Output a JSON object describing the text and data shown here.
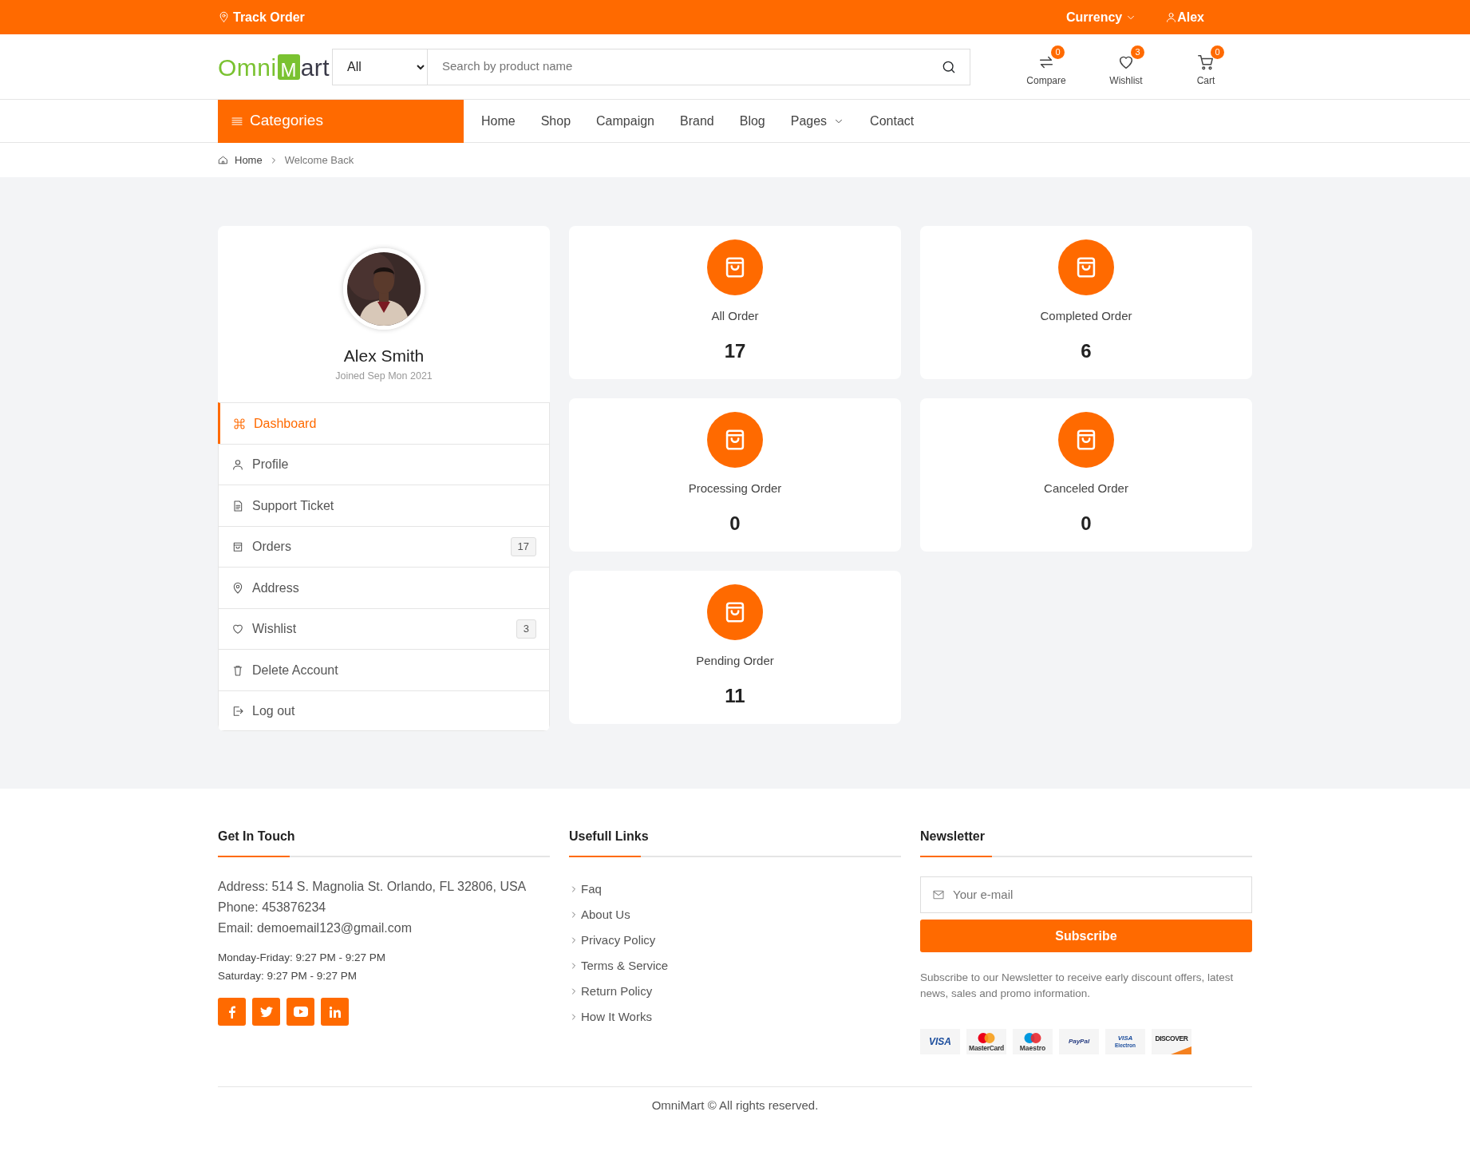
{
  "topbar": {
    "track_order": "Track Order",
    "currency": "Currency",
    "user": "Alex"
  },
  "logo": {
    "first": "Omni",
    "bag_letter": "M",
    "rest": "art"
  },
  "search": {
    "category": "All",
    "placeholder": "Search by product name"
  },
  "header_actions": [
    {
      "label": "Compare",
      "count": "0"
    },
    {
      "label": "Wishlist",
      "count": "3"
    },
    {
      "label": "Cart",
      "count": "0"
    }
  ],
  "categories_button": "Categories",
  "nav": [
    {
      "label": "Home",
      "has_caret": false
    },
    {
      "label": "Shop",
      "has_caret": false
    },
    {
      "label": "Campaign",
      "has_caret": false
    },
    {
      "label": "Brand",
      "has_caret": false
    },
    {
      "label": "Blog",
      "has_caret": false
    },
    {
      "label": "Pages",
      "has_caret": true
    },
    {
      "label": "Contact",
      "has_caret": false
    }
  ],
  "breadcrumb": [
    "Home",
    "Welcome Back"
  ],
  "profile": {
    "name": "Alex Smith",
    "joined": "Joined Sep Mon 2021"
  },
  "menu": [
    {
      "label": "Dashboard",
      "selected": true
    },
    {
      "label": "Profile",
      "selected": false
    },
    {
      "label": "Support Ticket",
      "selected": false
    },
    {
      "label": "Orders",
      "selected": false,
      "count": "17"
    },
    {
      "label": "Address",
      "selected": false
    },
    {
      "label": "Wishlist",
      "selected": false,
      "count": "3"
    },
    {
      "label": "Delete Account",
      "selected": false
    },
    {
      "label": "Log out",
      "selected": false
    }
  ],
  "stats": [
    {
      "label": "All Order",
      "value": "17"
    },
    {
      "label": "Completed Order",
      "value": "6"
    },
    {
      "label": "Processing Order",
      "value": "0"
    },
    {
      "label": "Canceled Order",
      "value": "0"
    },
    {
      "label": "Pending Order",
      "value": "11"
    }
  ],
  "footer": {
    "contact": {
      "title": "Get In Touch",
      "lines": [
        {
          "label": "Address:",
          "value": "514 S. Magnolia St. Orlando, FL 32806, USA"
        },
        {
          "label": "Phone:",
          "value": "453876234"
        },
        {
          "label": "Email:",
          "value": "demoemail123@gmail.com"
        }
      ],
      "hours": [
        {
          "label": "Monday-Friday:",
          "value": "9:27 PM - 9:27 PM"
        },
        {
          "label": "Saturday:",
          "value": "9:27 PM - 9:27 PM"
        }
      ]
    },
    "links": {
      "title": "Usefull Links",
      "items": [
        "Faq",
        "About Us",
        "Privacy Policy",
        "Terms & Service",
        "Return Policy",
        "How It Works"
      ]
    },
    "newsletter": {
      "title": "Newsletter",
      "placeholder": "Your e-mail",
      "button": "Subscribe",
      "note": "Subscribe to our Newsletter to receive early discount offers, latest news, sales and promo information.",
      "payments": [
        {
          "kind": "visa",
          "label": "VISA"
        },
        {
          "kind": "circles",
          "label": "MasterCard"
        },
        {
          "kind": "circles2",
          "label": "Maestro"
        },
        {
          "kind": "paypal",
          "label": "PayPal"
        },
        {
          "kind": "electron",
          "label": "VISA",
          "sub": "Electron"
        },
        {
          "kind": "discover",
          "label": "DISCOVER"
        }
      ]
    },
    "copyright": "OmniMart © All rights reserved."
  }
}
